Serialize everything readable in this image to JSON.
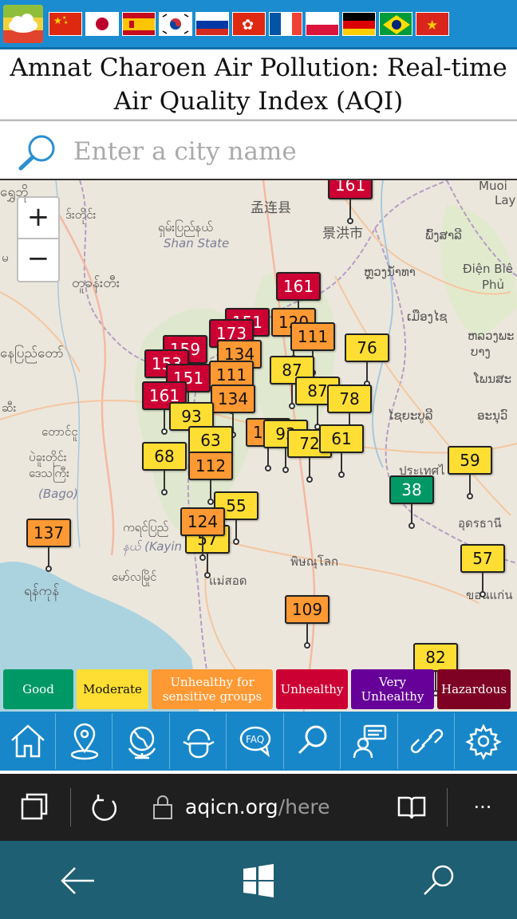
{
  "page": {
    "title": "Amnat Charoen Air Pollution: Real-time Air Quality Index (AQI)"
  },
  "flags": [
    "home-flag",
    "china-flag",
    "japan-flag",
    "spain-flag",
    "korea-flag",
    "russia-flag",
    "hongkong-flag",
    "france-flag",
    "poland-flag",
    "germany-flag",
    "brazil-flag",
    "vietnam-flag"
  ],
  "search": {
    "placeholder": "Enter a city name",
    "icon": "search-icon"
  },
  "map": {
    "zoom_in": "+",
    "zoom_out": "−",
    "labels": [
      {
        "text": "ရွှေဘို",
        "key": "l1"
      },
      {
        "text": "ဒ်းတိုင်း",
        "key": "l2"
      },
      {
        "text": "孟连县",
        "key": "l3"
      },
      {
        "text": "ရှမ်းပြည်နယ်",
        "key": "l4"
      },
      {
        "text": "Shan State",
        "key": "l5"
      },
      {
        "text": "景洪市",
        "key": "l6"
      },
      {
        "text": "ພົ້ງສາລີ",
        "key": "l7"
      },
      {
        "text": "Muoi",
        "key": "l8"
      },
      {
        "text": "Lay",
        "key": "l9"
      },
      {
        "text": "တူခန်းတီး",
        "key": "l10"
      },
      {
        "text": "Điện Biê",
        "key": "l11"
      },
      {
        "text": "Phủ",
        "key": "l12"
      },
      {
        "text": "ຫຼວງນ້ຳທາ",
        "key": "l13"
      },
      {
        "text": "ເມືອງໄຊ",
        "key": "l14"
      },
      {
        "text": "နေပြည်တော်",
        "key": "l15"
      },
      {
        "text": "ຫລວງພະ",
        "key": "l16"
      },
      {
        "text": "ບາງ",
        "key": "l17"
      },
      {
        "text": "ໂພນສະ",
        "key": "l18"
      },
      {
        "text": "ໄຊຍະບູລີ",
        "key": "l19"
      },
      {
        "text": "ອະນຸວົ",
        "key": "l20"
      },
      {
        "text": "တောင်ငူ",
        "key": "l21"
      },
      {
        "text": "ပဲခူးတိုင်း",
        "key": "l22"
      },
      {
        "text": "ဒေသကြီး",
        "key": "l23"
      },
      {
        "text": "(Bago)",
        "key": "l24"
      },
      {
        "text": "ประเทศไ",
        "key": "l25"
      },
      {
        "text": "ကရင်ပြည်",
        "key": "l26"
      },
      {
        "text": "နယ် (Kayin",
        "key": "l27"
      },
      {
        "text": "อุดรธานี",
        "key": "l28"
      },
      {
        "text": "พิษณุโลก",
        "key": "l29"
      },
      {
        "text": "ရန်ကုန်",
        "key": "l30"
      },
      {
        "text": "မော်လမြိုင်",
        "key": "l31"
      },
      {
        "text": "แม่สอด",
        "key": "l32"
      },
      {
        "text": "ขอนแก่น",
        "key": "l33"
      },
      {
        "text": "မ",
        "key": "l34"
      },
      {
        "text": "ဆီး",
        "key": "l35"
      }
    ],
    "markers": [
      {
        "value": "161",
        "level": "unhealthy",
        "key": "m1"
      },
      {
        "value": "161",
        "level": "unhealthy",
        "key": "m2"
      },
      {
        "value": "120",
        "level": "usg",
        "key": "m3"
      },
      {
        "value": "151",
        "level": "unhealthy",
        "key": "m4"
      },
      {
        "value": "173",
        "level": "unhealthy",
        "key": "m5"
      },
      {
        "value": "134",
        "level": "usg",
        "key": "m6"
      },
      {
        "value": "111",
        "level": "usg",
        "key": "m7"
      },
      {
        "value": "76",
        "level": "moderate",
        "key": "m8"
      },
      {
        "value": "159",
        "level": "unhealthy",
        "key": "m9"
      },
      {
        "value": "153",
        "level": "unhealthy",
        "key": "m10"
      },
      {
        "value": "151",
        "level": "unhealthy",
        "key": "m11"
      },
      {
        "value": "111",
        "level": "usg",
        "key": "m12"
      },
      {
        "value": "87",
        "level": "moderate",
        "key": "m13"
      },
      {
        "value": "87",
        "level": "moderate",
        "key": "m14"
      },
      {
        "value": "78",
        "level": "moderate",
        "key": "m15"
      },
      {
        "value": "161",
        "level": "unhealthy",
        "key": "m16"
      },
      {
        "value": "134",
        "level": "usg",
        "key": "m17"
      },
      {
        "value": "93",
        "level": "moderate",
        "key": "m18"
      },
      {
        "value": "109",
        "level": "usg",
        "key": "m19"
      },
      {
        "value": "93",
        "level": "moderate",
        "key": "m20"
      },
      {
        "value": "72",
        "level": "moderate",
        "key": "m21"
      },
      {
        "value": "61",
        "level": "moderate",
        "key": "m22"
      },
      {
        "value": "63",
        "level": "moderate",
        "key": "m23"
      },
      {
        "value": "68",
        "level": "moderate",
        "key": "m24"
      },
      {
        "value": "112",
        "level": "usg",
        "key": "m25"
      },
      {
        "value": "59",
        "level": "moderate",
        "key": "m26"
      },
      {
        "value": "38",
        "level": "good",
        "key": "m27"
      },
      {
        "value": "55",
        "level": "moderate",
        "key": "m28"
      },
      {
        "value": "124",
        "level": "usg",
        "key": "m29"
      },
      {
        "value": "57",
        "level": "moderate",
        "key": "m30"
      },
      {
        "value": "137",
        "level": "usg",
        "key": "m31"
      },
      {
        "value": "57",
        "level": "moderate",
        "key": "m32"
      },
      {
        "value": "109",
        "level": "usg",
        "key": "m33"
      },
      {
        "value": "82",
        "level": "moderate",
        "key": "m34"
      }
    ]
  },
  "legend": [
    {
      "label": "Good",
      "color": "#009966"
    },
    {
      "label": "Moderate",
      "color": "#ffde33"
    },
    {
      "label": "Unhealthy for sensitive groups",
      "color": "#ff9933"
    },
    {
      "label": "Unhealthy",
      "color": "#cc0033"
    },
    {
      "label": "Very Unhealthy",
      "color": "#660099"
    },
    {
      "label": "Hazardous",
      "color": "#7e0023"
    }
  ],
  "level_colors": {
    "good": "#009966",
    "moderate": "#ffde33",
    "usg": "#ff9933",
    "unhealthy": "#cc0033"
  },
  "nav": [
    "home-icon",
    "map-pin-icon",
    "globe-icon",
    "mask-icon",
    "faq-icon",
    "search-icon",
    "feedback-icon",
    "link-icon",
    "gear-icon"
  ],
  "browser": {
    "url_host": "aqicn.org",
    "url_path": "/here",
    "more": "···"
  },
  "windows": [
    "back-icon",
    "windows-logo-icon",
    "search-icon"
  ]
}
